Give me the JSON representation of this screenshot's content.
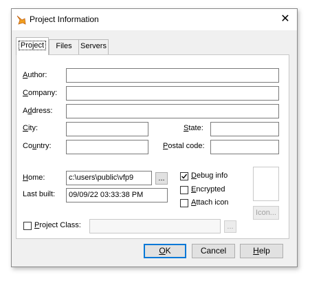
{
  "window": {
    "title": "Project Information",
    "close_glyph": "✕",
    "icon": "fox-icon"
  },
  "tabs": [
    {
      "label": "Project",
      "active": true
    },
    {
      "label": "Files",
      "active": false
    },
    {
      "label": "Servers",
      "active": false
    }
  ],
  "fields": {
    "author": {
      "label": "Author:",
      "value": ""
    },
    "company": {
      "label": "Company:",
      "value": ""
    },
    "address": {
      "label": "Address:",
      "value": ""
    },
    "city": {
      "label": "City:",
      "value": ""
    },
    "state": {
      "label": "State:",
      "value": ""
    },
    "country": {
      "label": "Country:",
      "value": ""
    },
    "postal": {
      "label": "Postal code:",
      "value": ""
    },
    "home": {
      "label": "Home:",
      "value": "c:\\users\\public\\vfp9"
    },
    "last_built": {
      "label": "Last built:",
      "value": "09/09/22 03:33:38 PM"
    },
    "project_class": {
      "label": "Project Class:",
      "value": ""
    }
  },
  "browse_label": "...",
  "options": {
    "debug_info": {
      "label": "Debug info",
      "checked": true
    },
    "encrypted": {
      "label": "Encrypted",
      "checked": false
    },
    "attach_icon": {
      "label": "Attach icon",
      "checked": false
    }
  },
  "icon_button": "Icon...",
  "buttons": {
    "ok": "OK",
    "cancel": "Cancel",
    "help": "Help"
  }
}
